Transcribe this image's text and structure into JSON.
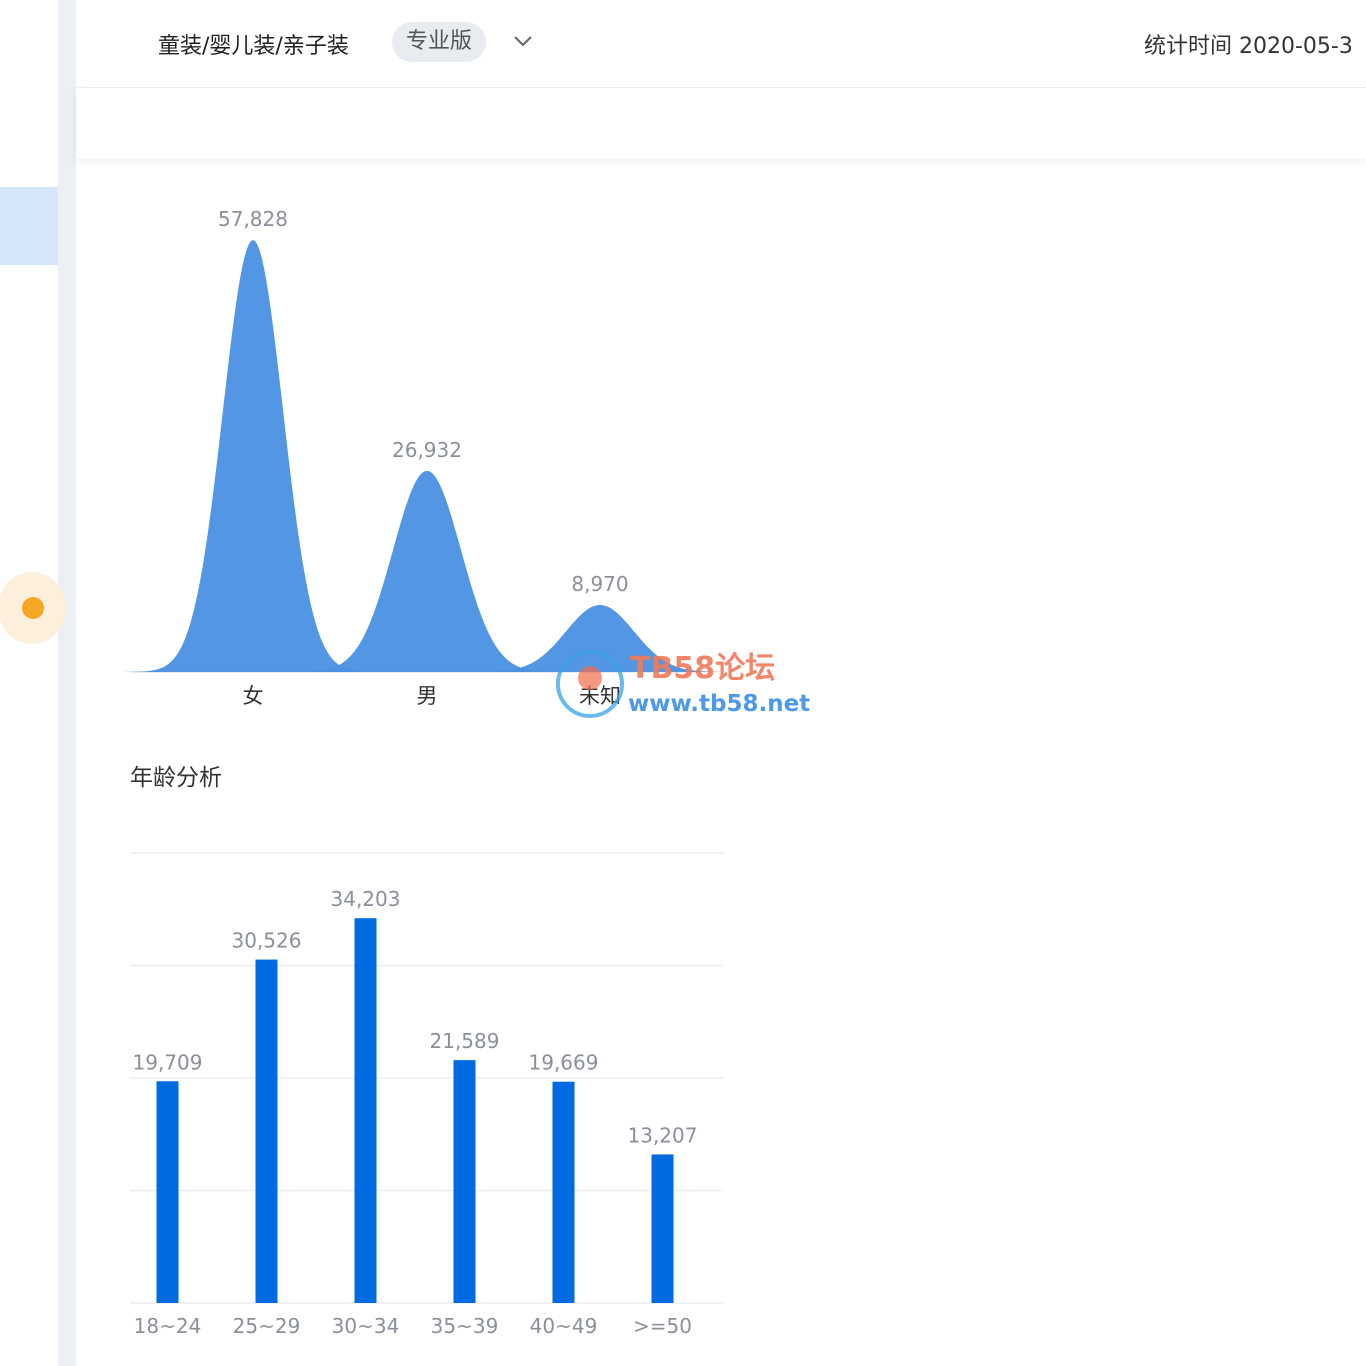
{
  "header": {
    "category": "童装/婴儿装/亲子装",
    "edition_badge": "专业版",
    "stat_time": "统计时间 2020-05-3"
  },
  "gender_chart": {
    "chart_data": {
      "type": "area",
      "categories": [
        "女",
        "男",
        "未知"
      ],
      "values": [
        57828,
        26932,
        8970
      ],
      "value_labels": [
        "57,828",
        "26,932",
        "8,970"
      ],
      "color": "#4a90e2"
    }
  },
  "age_section": {
    "title": "年龄分析"
  },
  "age_chart": {
    "chart_data": {
      "type": "bar",
      "categories": [
        "18~24",
        "25~29",
        "30~34",
        "35~39",
        "40~49",
        ">=50"
      ],
      "values": [
        19709,
        30526,
        34203,
        21589,
        19669,
        13207
      ],
      "value_labels": [
        "19,709",
        "30,526",
        "34,203",
        "21,589",
        "19,669",
        "13,207"
      ],
      "ylim": [
        0,
        40000
      ],
      "grid": true,
      "color": "#006ae1"
    }
  },
  "watermark": {
    "title": "TB58论坛",
    "url": "www.tb58.net"
  }
}
